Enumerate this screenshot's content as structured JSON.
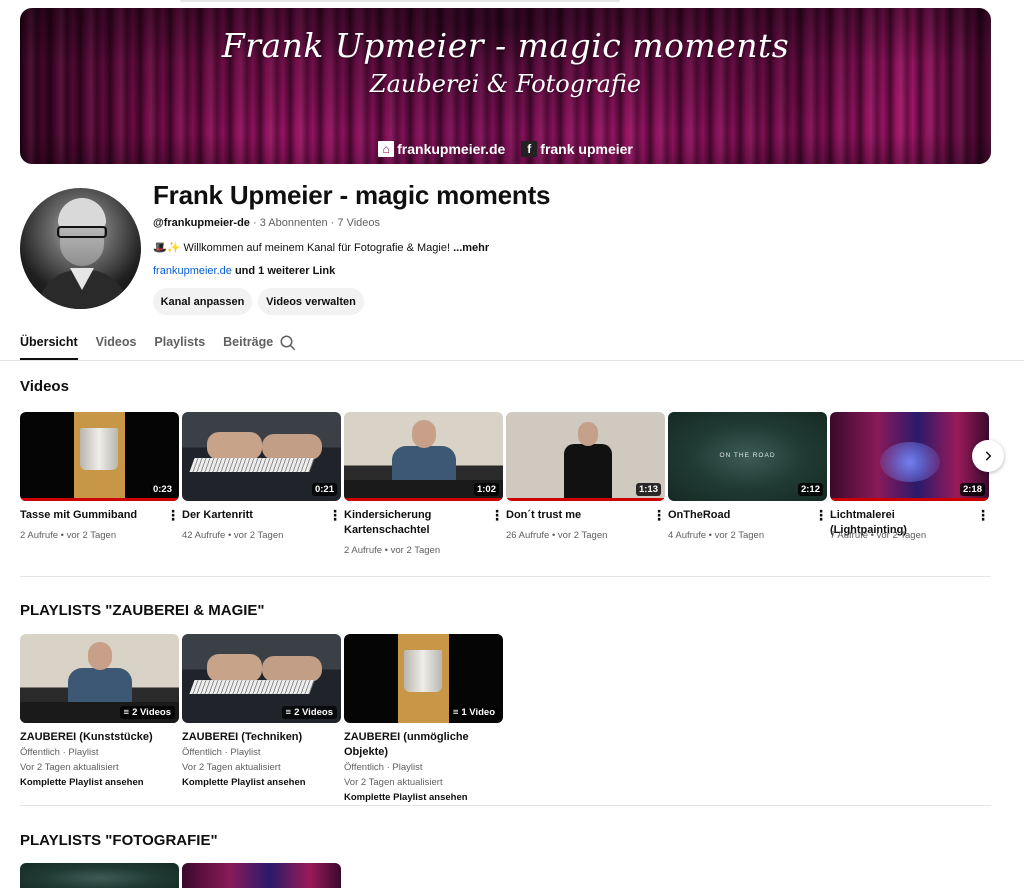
{
  "banner": {
    "title": "Frank Upmeier - magic moments",
    "subtitle": "Zauberei & Fotografie",
    "links": [
      {
        "icon": "home-icon",
        "label": "frankupmeier.de"
      },
      {
        "icon": "facebook-icon",
        "label": "frank upmeier"
      }
    ]
  },
  "channel": {
    "name": "Frank Upmeier - magic moments",
    "handle": "@frankupmeier-de",
    "subscribers": "3 Abonnenten",
    "video_count": "7 Videos",
    "description_emoji": "🎩✨",
    "description": "Willkommen auf meinem Kanal für Fotografie & Magie!",
    "more_label": "...mehr",
    "link_primary": "frankupmeier.de",
    "link_rest": "und 1 weiterer Link",
    "customize_button": "Kanal anpassen",
    "manage_button": "Videos verwalten"
  },
  "tabs": [
    {
      "label": "Übersicht",
      "active": true
    },
    {
      "label": "Videos",
      "active": false
    },
    {
      "label": "Playlists",
      "active": false
    },
    {
      "label": "Beiträge",
      "active": false
    }
  ],
  "videos_section": {
    "title": "Videos",
    "items": [
      {
        "title": "Tasse mit Gummiband",
        "duration": "0:23",
        "views": "2 Aufrufe",
        "age": "vor 2 Tagen"
      },
      {
        "title": "Der Kartenritt",
        "duration": "0:21",
        "views": "42 Aufrufe",
        "age": "vor 2 Tagen"
      },
      {
        "title": "Kindersicherung Kartenschachtel",
        "duration": "1:02",
        "views": "2 Aufrufe",
        "age": "vor 2 Tagen"
      },
      {
        "title": "Don´t trust me",
        "duration": "1:13",
        "views": "26 Aufrufe",
        "age": "vor 2 Tagen"
      },
      {
        "title": "OnTheRoad",
        "duration": "2:12",
        "views": "4 Aufrufe",
        "age": "vor 2 Tagen",
        "thumb_text": "ON THE ROAD"
      },
      {
        "title": "Lichtmalerei (Lightpainting)",
        "duration": "2:18",
        "views": "7 Aufrufe",
        "age": "vor 2 Tagen"
      }
    ]
  },
  "playlists_magic": {
    "title": "PLAYLISTS \"ZAUBEREI & MAGIE\"",
    "items": [
      {
        "title": "ZAUBEREI (Kunststücke)",
        "count": "2 Videos",
        "visibility": "Öffentlich · Playlist",
        "updated": "Vor 2 Tagen aktualisiert",
        "link": "Komplette Playlist ansehen"
      },
      {
        "title": "ZAUBEREI (Techniken)",
        "count": "2 Videos",
        "visibility": "Öffentlich · Playlist",
        "updated": "Vor 2 Tagen aktualisiert",
        "link": "Komplette Playlist ansehen"
      },
      {
        "title": "ZAUBEREI (unmögliche Objekte)",
        "count": "1 Video",
        "visibility": "Öffentlich · Playlist",
        "updated": "Vor 2 Tagen aktualisiert",
        "link": "Komplette Playlist ansehen"
      }
    ]
  },
  "playlists_photo": {
    "title": "PLAYLISTS \"FOTOGRAFIE\""
  },
  "colors": {
    "progress_red": "#cc0000",
    "link_blue": "#065fd4",
    "banner_magenta": "#a3146a"
  }
}
